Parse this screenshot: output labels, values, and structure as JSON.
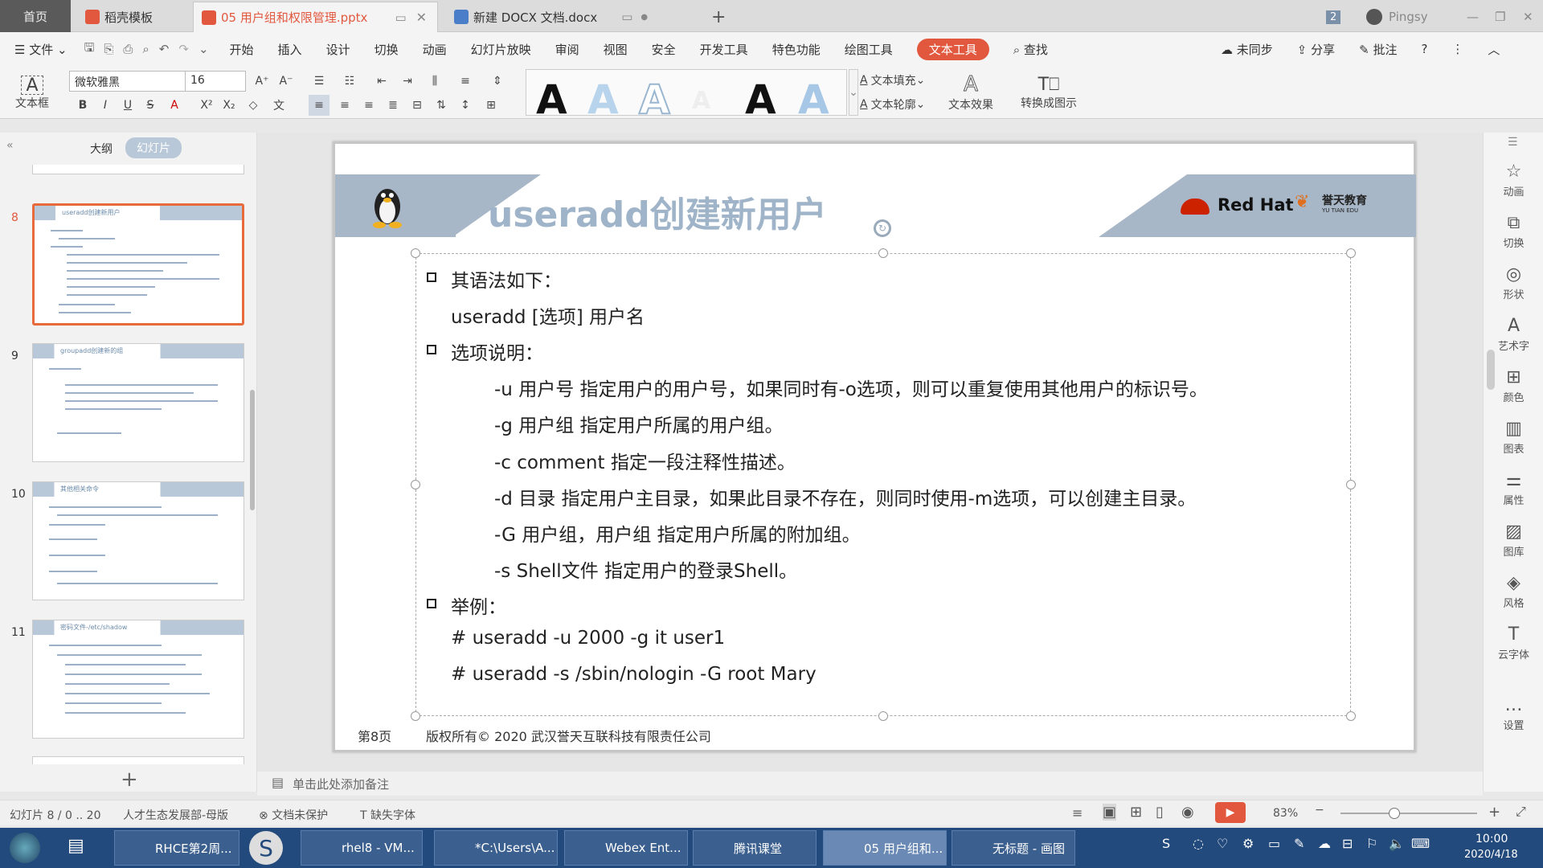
{
  "tabs": [
    {
      "label": "首页"
    },
    {
      "label": "稻壳模板"
    },
    {
      "label": "05 用户组和权限管理.pptx"
    },
    {
      "label": "新建 DOCX 文档.docx"
    }
  ],
  "window": {
    "page_count": "2",
    "user": "Pingsy"
  },
  "menu": {
    "file": "文件",
    "items": [
      "开始",
      "插入",
      "设计",
      "切换",
      "动画",
      "幻灯片放映",
      "审阅",
      "视图",
      "安全",
      "开发工具",
      "特色功能",
      "绘图工具",
      "文本工具"
    ],
    "search": "查找",
    "right": [
      "未同步",
      "分享",
      "批注"
    ]
  },
  "ribbon": {
    "textbox": "文本框",
    "font_name": "微软雅黑",
    "font_size": "16",
    "text_fill": "文本填充",
    "text_outline": "文本轮廓",
    "text_effect": "文本效果",
    "convert": "转换成图示"
  },
  "panel": {
    "tab_outline": "大纲",
    "tab_slides": "幻灯片",
    "thumbs": [
      {
        "num": "8",
        "title": "useradd创建新用户"
      },
      {
        "num": "9",
        "title": "groupadd创建新的组"
      },
      {
        "num": "10",
        "title": "其他相关命令"
      },
      {
        "num": "11",
        "title": "密码文件-/etc/shadow"
      }
    ]
  },
  "slide": {
    "title": "useradd创建新用户",
    "brand": "Red Hat",
    "brand2": "誉天教育",
    "brand2_sub": "YU TIAN EDU",
    "lines": [
      "其语法如下：",
      "useradd  [选项]  用户名",
      "选项说明：",
      "-u 用户号 指定用户的用户号，如果同时有-o选项，则可以重复使用其他用户的标识号。",
      "-g 用户组 指定用户所属的用户组。",
      "-c comment 指定一段注释性描述。",
      "-d 目录 指定用户主目录，如果此目录不存在，则同时使用-m选项，可以创建主目录。",
      "-G 用户组，用户组 指定用户所属的附加组。",
      "-s Shell文件 指定用户的登录Shell。",
      "举例：",
      "# useradd -u 2000 -g it  user1",
      "# useradd -s /sbin/nologin  -G root  Mary"
    ],
    "page": "第8页",
    "copyright": "版权所有© 2020 武汉誉天互联科技有限责任公司"
  },
  "notes": "单击此处添加备注",
  "rightbar": [
    "动画",
    "切换",
    "形状",
    "艺术字",
    "颜色",
    "图表",
    "属性",
    "图库",
    "风格",
    "云字体",
    "设置"
  ],
  "status": {
    "slide": "幻灯片 8 / 0 .. 20",
    "theme": "人才生态发展部-母版",
    "protect": "文档未保护",
    "font": "缺失字体",
    "zoom": "83%"
  },
  "taskbar": {
    "items": [
      "RHCE第2周...",
      "rhel8 - VM...",
      "*C:\\Users\\A...",
      "Webex Ent...",
      "腾讯课堂",
      "05 用户组和...",
      "无标题 - 画图"
    ],
    "time": "10:00",
    "date": "2020/4/18"
  }
}
